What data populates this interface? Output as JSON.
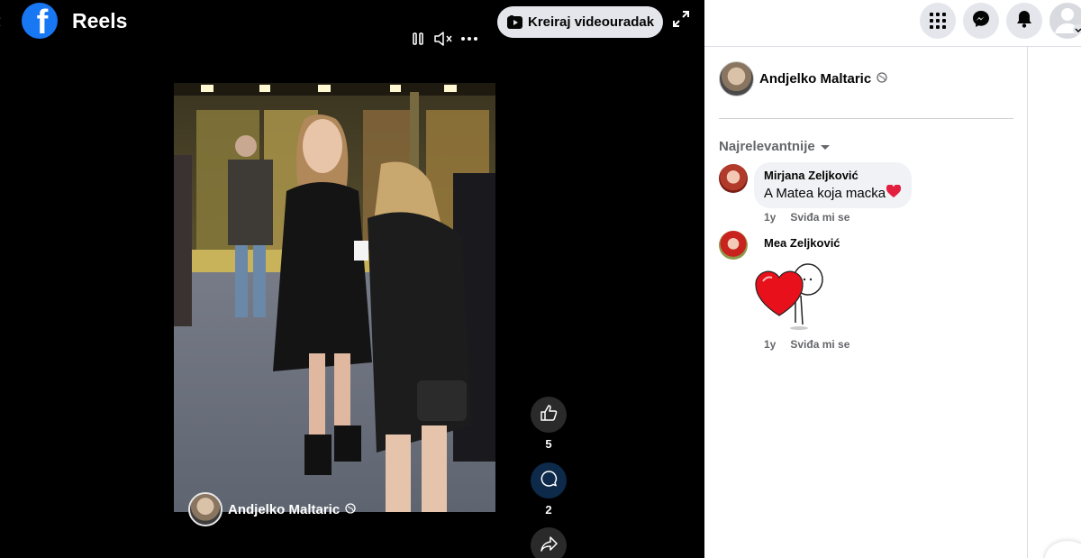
{
  "header": {
    "title": "Reels",
    "create_button_label": "Kreiraj videouradak",
    "logo_icon": "facebook-logo"
  },
  "video": {
    "author_name": "Andjelko Maltaric",
    "likes_count": "5",
    "comments_count": "2"
  },
  "panel": {
    "post_author_name": "Andjelko Maltaric",
    "sort_label": "Najrelevantnije",
    "comments": [
      {
        "author": "Mirjana Zeljković",
        "text": "A Matea koja macka",
        "emoji": "❤️",
        "time": "1y",
        "like_label": "Sviđa mi se"
      },
      {
        "author": "Mea Zeljković",
        "sticker": "heart-hug-sticker",
        "time": "1y",
        "like_label": "Sviđa mi se"
      }
    ]
  },
  "colors": {
    "facebook_blue": "#1877f2",
    "viewer_bg": "#000000",
    "panel_bg": "#ffffff",
    "bubble_bg": "#f0f2f5",
    "secondary_text": "#65676b"
  }
}
